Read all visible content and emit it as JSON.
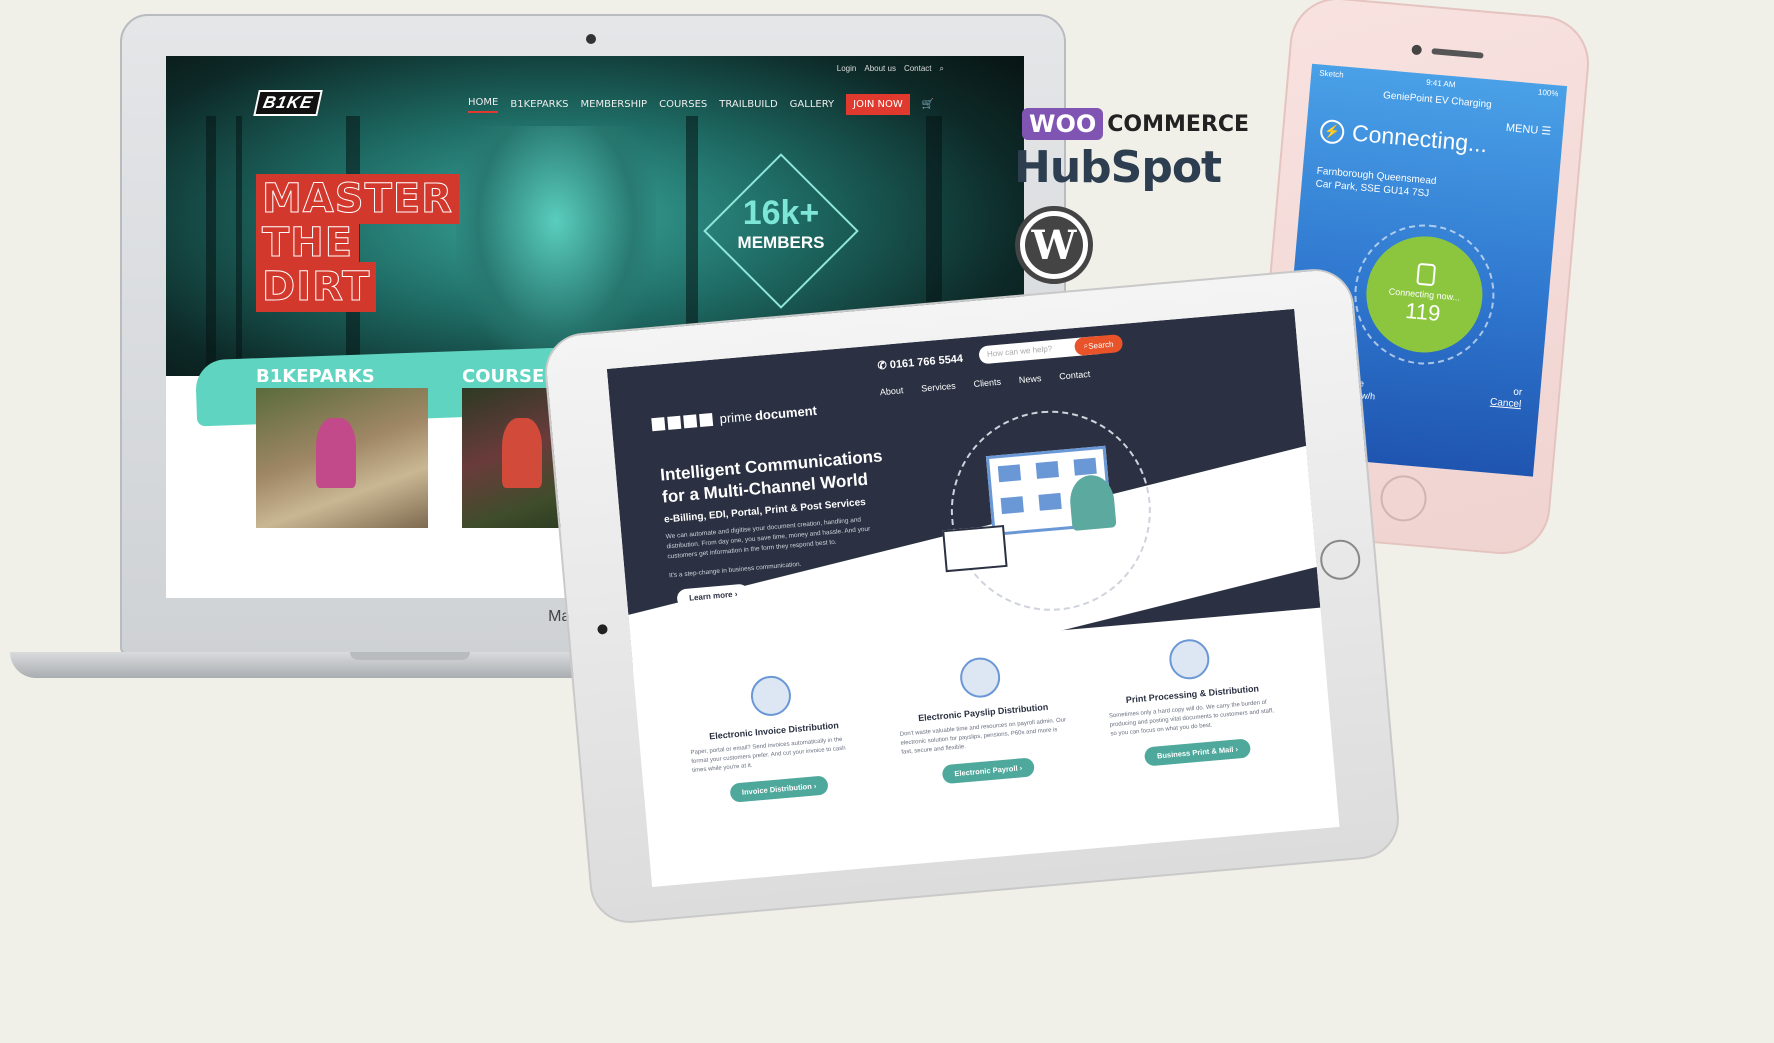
{
  "laptop": {
    "brand_label": "MacBook Air",
    "site": {
      "logo": "B1KE",
      "top_links": [
        "Login",
        "About us",
        "Contact"
      ],
      "nav": [
        "HOME",
        "B1KEPARKS",
        "MEMBERSHIP",
        "COURSES",
        "TRAILBUILD",
        "GALLERY"
      ],
      "join_label": "JOIN NOW",
      "headline": [
        "MASTER",
        "THE",
        "DIRT"
      ],
      "stat_big": "16k+",
      "stat_small": "MEMBERS",
      "sections": [
        "B1KEPARKS",
        "COURSES"
      ]
    }
  },
  "logos": {
    "woo_mark": "WOO",
    "woo_text": "COMMERCE",
    "hubspot": "HubSpot",
    "wordpress": "W"
  },
  "phone": {
    "status_left": "Sketch",
    "status_time": "9:41 AM",
    "status_right": "100%",
    "app_title": "GeniePoint EV Charging",
    "menu": "MENU",
    "connecting": "Connecting...",
    "location_line1": "Farnborough Queensmead",
    "location_line2": "Car Park, SSE GU14 7SJ",
    "ring_label": "Connecting now...",
    "ring_number": "119",
    "cable_line1": "43 Kw AC Cable",
    "cable_line2": "£1.00 + £0.30 Kw/h",
    "or": "or",
    "cancel": "Cancel"
  },
  "tablet": {
    "logo_light": "prime",
    "logo_bold": "document",
    "phone": "0161 766 5544",
    "search_placeholder": "How can we help?",
    "search_btn": "Search",
    "nav": [
      "About",
      "Services",
      "Clients",
      "News",
      "Contact"
    ],
    "headline_1": "Intelligent Communications",
    "headline_2": "for a Multi-Channel World",
    "subhead": "e-Billing, EDI, Portal, Print & Post Services",
    "body": "We can automate and digitise your document creation, handling and distribution. From day one, you save time, money and hassle. And your customers get information in the form they respond best to.",
    "body2": "It's a step-change in business communication.",
    "learn_more": "Learn more ›",
    "services": [
      {
        "title": "Electronic Invoice Distribution",
        "text": "Paper, portal or email? Send invoices automatically in the format your customers prefer. And cut your invoice to cash times while you're at it.",
        "btn": "Invoice Distribution ›"
      },
      {
        "title": "Electronic Payslip Distribution",
        "text": "Don't waste valuable time and resources on payroll admin. Our electronic solution for payslips, pensions, P60s and more is fast, secure and flexible.",
        "btn": "Electronic Payroll ›"
      },
      {
        "title": "Print Processing & Distribution",
        "text": "Sometimes only a hard copy will do. We carry the burden of producing and posting vital documents to customers and staff, so you can focus on what you do best.",
        "btn": "Business Print & Mail ›"
      }
    ]
  }
}
